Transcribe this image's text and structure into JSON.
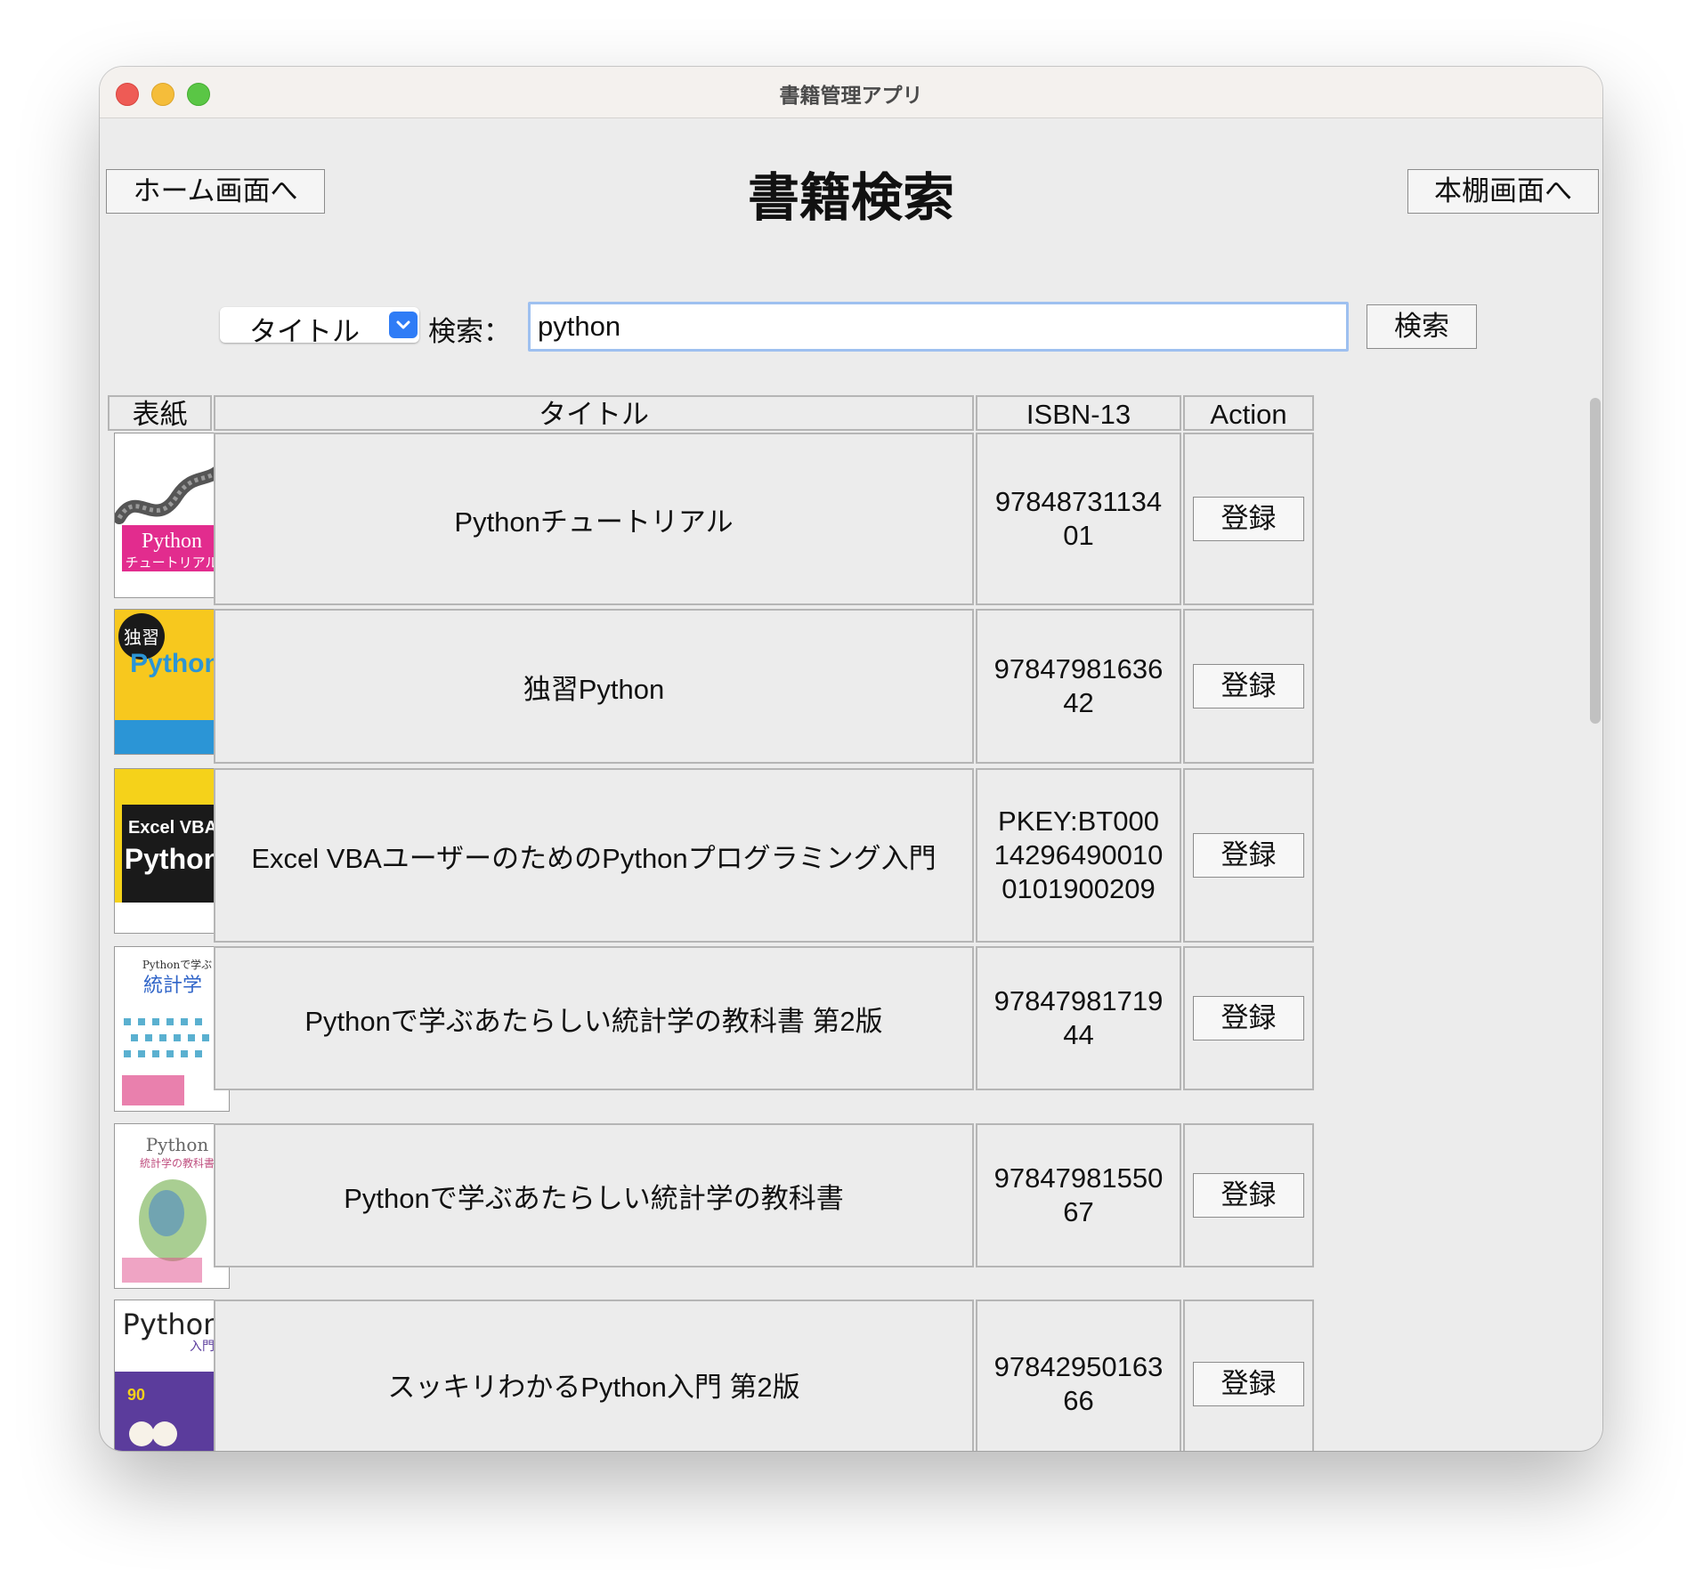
{
  "window": {
    "title": "書籍管理アプリ"
  },
  "header": {
    "home_button": "ホーム画面へ",
    "page_title": "書籍検索",
    "shelf_button": "本棚画面へ"
  },
  "search": {
    "field_select": "タイトル",
    "label": "検索：",
    "query": "python",
    "button": "検索"
  },
  "table": {
    "headers": [
      "表紙",
      "タイトル",
      "ISBN-13",
      "Action"
    ],
    "rows": [
      {
        "title": "Pythonチュートリアル",
        "isbn": "9784873113401",
        "action": "登録",
        "cover": {
          "text": "Python",
          "subtext": "チュートリアル",
          "colors": [
            "#ffffff",
            "#e22c8e"
          ]
        }
      },
      {
        "title": "独習Python",
        "isbn": "9784798163642",
        "action": "登録",
        "cover": {
          "text": "Python",
          "subtext": "独習",
          "colors": [
            "#f7c81e",
            "#2b95d6"
          ]
        }
      },
      {
        "title": "Excel VBAユーザーのためのPythonプログラミング入門",
        "isbn": "PKEY:BT000142964900100101900209",
        "action": "登録",
        "cover": {
          "text": "Python",
          "subtext": "Excel VBA",
          "colors": [
            "#f5d21a",
            "#1a1a1a"
          ]
        }
      },
      {
        "title": "Pythonで学ぶあたらしい統計学の教科書 第2版",
        "isbn": "9784798171944",
        "action": "登録",
        "cover": {
          "text": "統計学",
          "subtext": "Pythonで学ぶ",
          "colors": [
            "#ffffff",
            "#2f64c8"
          ]
        }
      },
      {
        "title": "Pythonで学ぶあたらしい統計学の教科書",
        "isbn": "9784798155067",
        "action": "登録",
        "cover": {
          "text": "Python",
          "subtext": "統計学の教科書",
          "colors": [
            "#ffffff",
            "#6fae4a"
          ]
        }
      },
      {
        "title": "スッキリわかるPython入門 第2版",
        "isbn": "9784295016366",
        "action": "登録",
        "cover": {
          "text": "Python",
          "subtext": "入門",
          "colors": [
            "#ffffff",
            "#5b3c9c"
          ]
        }
      }
    ]
  },
  "colors": {
    "accent": "#2f7cf6",
    "window_bg": "#ececec"
  }
}
